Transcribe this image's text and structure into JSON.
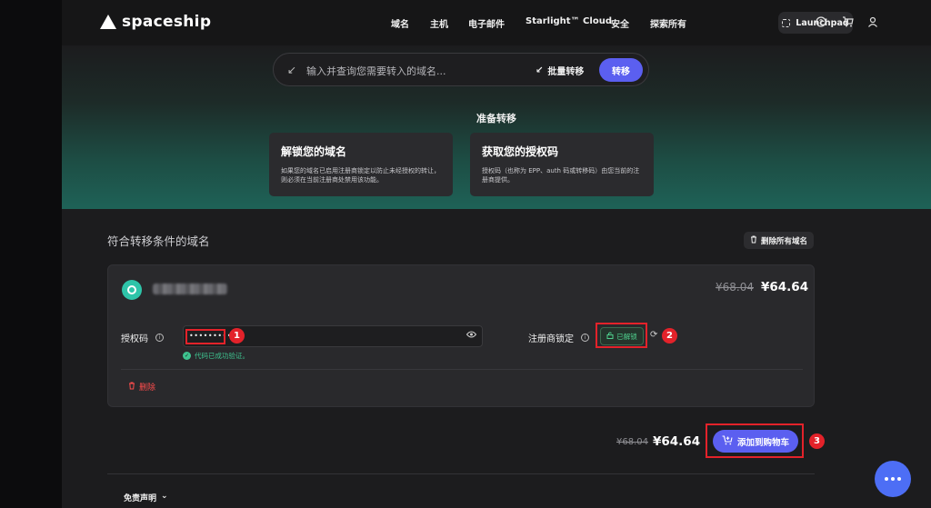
{
  "nav": {
    "brand": "spaceship",
    "items": [
      "域名",
      "主机",
      "电子邮件",
      "Starlight™ Cloud",
      "安全",
      "探索所有"
    ],
    "launchpad": "Launchpad",
    "icons": [
      "help-icon",
      "cart-icon",
      "user-icon"
    ]
  },
  "search": {
    "placeholder": "输入并查询您需要转入的域名...",
    "bulk_label": "批量转移",
    "submit_label": "转移"
  },
  "prep": {
    "title": "准备转移",
    "cards": [
      {
        "title": "解锁您的域名",
        "desc": "如果您的域名已启用注册商锁定以防止未经授权的转让，则必须在当前注册商处禁用该功能。"
      },
      {
        "title": "获取您的授权码",
        "desc": "授权码（也称为 EPP、auth 码或转移码）由您当前的注册商提供。"
      }
    ]
  },
  "eligible": {
    "title": "符合转移条件的域名",
    "remove_all": "删除所有域名"
  },
  "domain": {
    "old_price": "¥68.04",
    "new_price": "¥64.64",
    "auth_label": "授权码",
    "auth_value": "•••••••••••",
    "verified": "代码已成功验证。",
    "lock_label": "注册商锁定",
    "lock_status": "已解锁",
    "delete_label": "删除"
  },
  "summary": {
    "old_total": "¥68.04",
    "new_total": "¥64.64",
    "add_to_cart": "添加到购物车"
  },
  "annotations": [
    "1",
    "2",
    "3"
  ],
  "footer": {
    "disclaimer": "免责声明"
  },
  "colors": {
    "accent": "#5b5ff0",
    "highlight": "#e3222a",
    "success": "#3ec28f"
  }
}
